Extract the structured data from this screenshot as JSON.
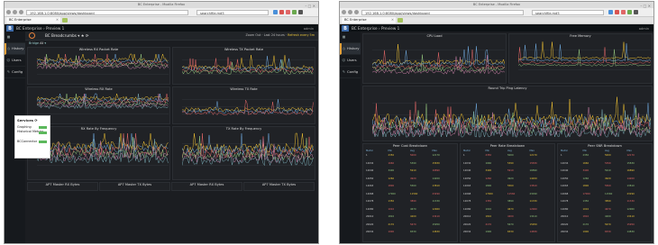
{
  "browser": {
    "window_title": "BC Enterprise - Mozilla Firefox",
    "url": "192.168.1.0:8080/app/views/dashboard",
    "search": "searchfile.md5",
    "tab_label": "BC Enterprise"
  },
  "app": {
    "title": "BC Enterprise",
    "subtitle": "Preview 1",
    "user": "admin"
  },
  "sidebar": [
    {
      "label": "Overview",
      "icon": "grid-icon"
    },
    {
      "label": "History",
      "icon": "clock-icon"
    },
    {
      "label": "Users",
      "icon": "users-icon"
    },
    {
      "label": "Config",
      "icon": "wrench-icon"
    }
  ],
  "left": {
    "dashboard_name": "BC Breadcrumbs",
    "time_range": "Zoom Out",
    "time_last": "Last 24 hours",
    "refresh": "Refresh every 5m",
    "filter_label": "Bridge",
    "filter_value": "All",
    "panels": [
      {
        "title": "Wireless RX Packet Rate"
      },
      {
        "title": "Wireless TX Packet Rate"
      },
      {
        "title": "Wireless RX Rate"
      },
      {
        "title": "Wireless TX Rate"
      },
      {
        "title": "RX Rate By Frequency"
      },
      {
        "title": "TX Rate By Frequency"
      },
      {
        "title": "AP7 Master RX Bytes"
      },
      {
        "title": "AP7 Master TX Bytes"
      },
      {
        "title": "AP7 Master RX Bytes"
      },
      {
        "title": "AP7 Master TX Bytes"
      }
    ],
    "services": {
      "header": "Services",
      "items": [
        {
          "label": "Graphing",
          "status": "Running"
        },
        {
          "label": "Historical Metrics",
          "status": "Running"
        },
        {
          "label": "BCConnector",
          "status": "Running"
        }
      ]
    },
    "y_ticks": [
      "1.5 Mbps",
      "1 Mbps",
      "500 kbps",
      "0 bps"
    ],
    "x_ticks": [
      "00:00",
      "04:00",
      "08:00",
      "12:00",
      "16:00",
      "20:00"
    ]
  },
  "right": {
    "panels": [
      {
        "title": "CPU Load"
      },
      {
        "title": "Free Memory"
      },
      {
        "title": "Round Trip Ping Latency"
      },
      {
        "title": "Peer Cost Breakdown"
      },
      {
        "title": "Peer Rate Breakdown"
      },
      {
        "title": "Peer SNR Breakdown"
      }
    ],
    "table_headers": {
      "cost": [
        "Metric",
        "Min",
        "Avg",
        "Max"
      ],
      "rate": [
        "Metric",
        "Min",
        "Avg",
        "Max"
      ],
      "snr": [
        "Metric",
        "Min",
        "Avg",
        "Max"
      ]
    },
    "table_rows": [
      [
        "1",
        "2350",
        "5000",
        "12170"
      ],
      [
        "12034",
        "1660",
        "5390",
        "15830"
      ],
      [
        "12040",
        "3400",
        "5910",
        "16890"
      ],
      [
        "12050",
        "1260",
        "4920",
        "14200"
      ],
      [
        "12063",
        "1800",
        "5560",
        "13810"
      ],
      [
        "12068",
        "17000",
        "11560",
        "23290"
      ],
      [
        "12078",
        "1350",
        "3890",
        "11330"
      ],
      [
        "12080",
        "1010",
        "4670",
        "12960"
      ],
      [
        "20010",
        "1810",
        "4200",
        "13410"
      ],
      [
        "20020",
        "2170",
        "5670",
        "15950"
      ],
      [
        "20034",
        "1900",
        "6530",
        "14830"
      ]
    ]
  },
  "colors": {
    "accent": "#e5a13a",
    "ok": "#5cb85c",
    "series": [
      "#f1c232",
      "#6fa8dc",
      "#e06666",
      "#93c47d",
      "#c27ba0",
      "#76a5af"
    ]
  }
}
